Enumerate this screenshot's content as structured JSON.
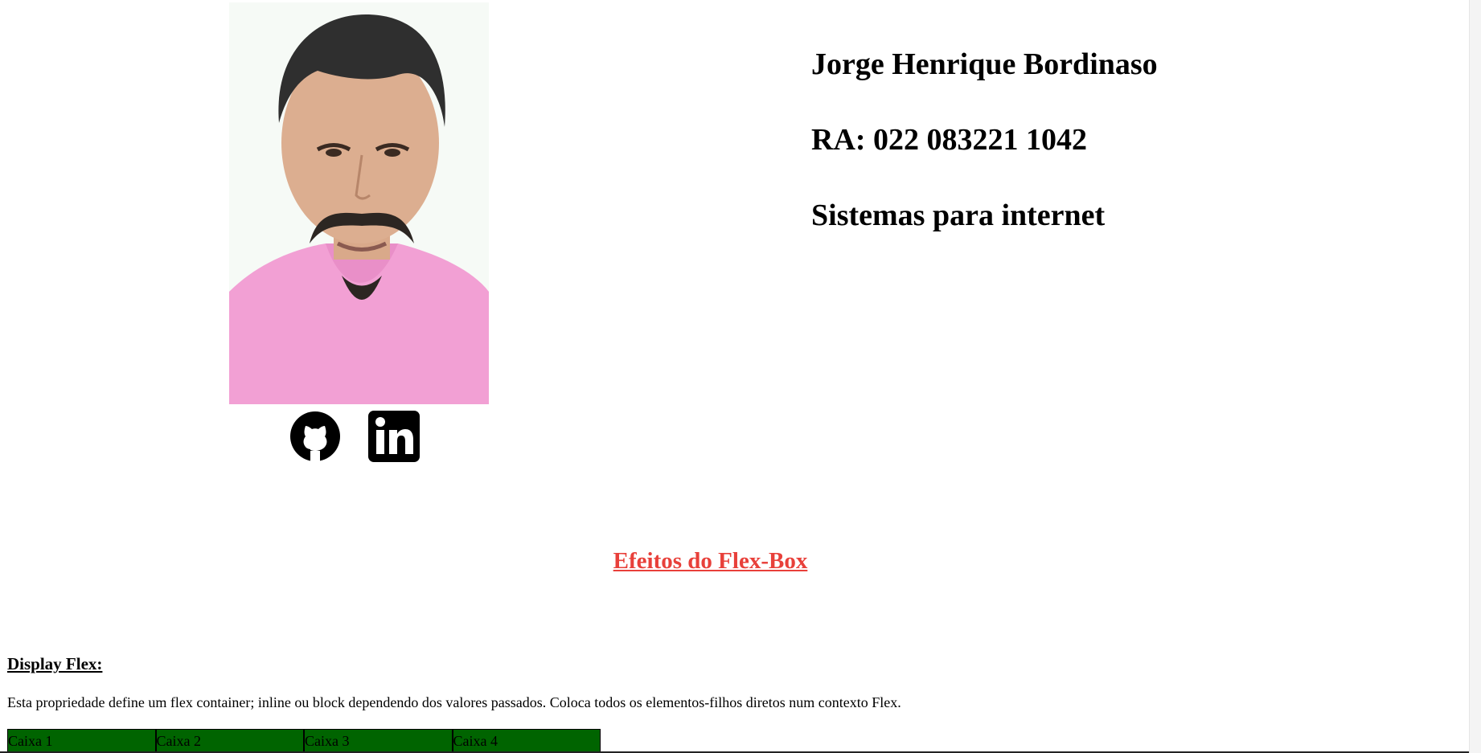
{
  "profile": {
    "name": "Jorge Henrique Bordinaso",
    "ra": "RA: 022 083221 1042",
    "course": "Sistemas para internet"
  },
  "social": {
    "github_icon": "github-icon",
    "linkedin_icon": "linkedin-icon"
  },
  "section": {
    "title": "Efeitos do Flex-Box"
  },
  "display_flex": {
    "heading": "Display Flex:",
    "description": "Esta propriedade define um flex container; inline ou block dependendo dos valores passados. Coloca todos os elementos-filhos diretos num contexto Flex.",
    "boxes": [
      "Caixa 1",
      "Caixa 2",
      "Caixa 3",
      "Caixa 4"
    ]
  },
  "colors": {
    "title": "#e8403a",
    "box_background": "#006400",
    "shirt": "#f2a0d4"
  }
}
